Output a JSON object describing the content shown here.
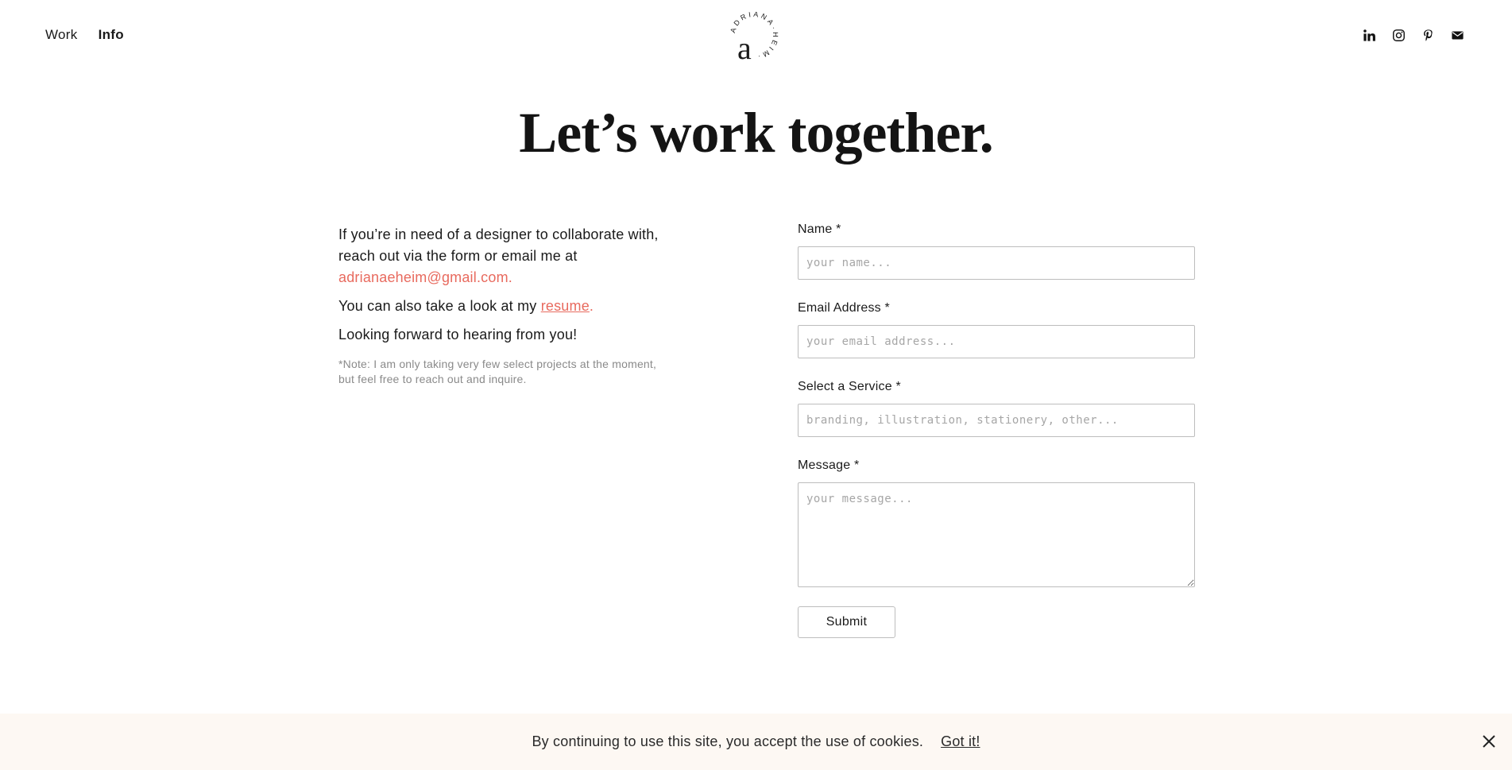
{
  "nav": {
    "items": [
      "Work",
      "Info"
    ]
  },
  "logo": {
    "letter": "a",
    "ring_text": "ADRIANA·HEIM·"
  },
  "social": [
    {
      "icon": "linkedin-icon"
    },
    {
      "icon": "instagram-icon"
    },
    {
      "icon": "pinterest-icon"
    },
    {
      "icon": "mail-icon"
    }
  ],
  "title": "Let’s work together.",
  "intro": {
    "p1": "If you’re in need of a designer to collaborate with, reach out via the form or email me at",
    "email": "adrianaeheim@gmail.com.",
    "p2_prefix": "You can also take a look at my",
    "resume": "resume",
    "p2_suffix": ".",
    "p3": "Looking forward to hearing from you!",
    "note": "*Note: I am only taking very few select projects at the moment, but feel free to reach out and inquire."
  },
  "form": {
    "name_label": "Name *",
    "name_placeholder": "your name...",
    "email_label": "Email Address *",
    "email_placeholder": "your email address...",
    "service_label": "Select a Service *",
    "service_placeholder": "branding, illustration, stationery, other...",
    "message_label": "Message *",
    "message_placeholder": "your message...",
    "submit_label": "Submit"
  },
  "cookie": {
    "text": "By continuing to use this site, you accept the use of cookies.",
    "accept": "Got it!"
  },
  "colors": {
    "accent": "#e86a5e",
    "banner_bg": "#fdf8f3",
    "text": "#1a1a1a"
  }
}
